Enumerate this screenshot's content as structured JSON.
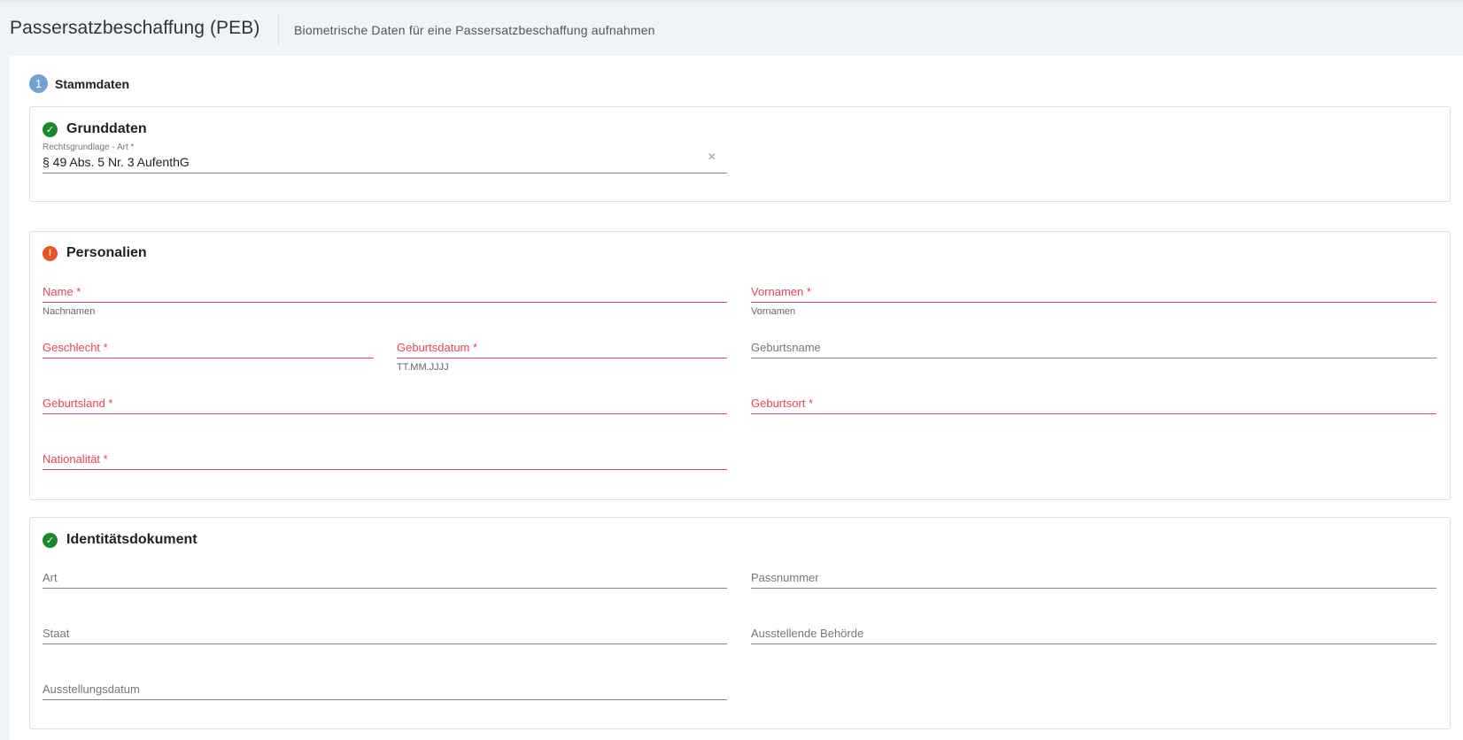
{
  "header": {
    "title": "Passersatzbeschaffung (PEB)",
    "subtitle": "Biometrische Daten für eine Passersatzbeschaffung aufnahmen"
  },
  "step": {
    "number": "1",
    "label": "Stammdaten"
  },
  "grunddaten": {
    "title": "Grunddaten",
    "status": "complete",
    "rechtsgrundlage_label": "Rechtsgrundlage - Art *",
    "rechtsgrundlage_value": "§ 49 Abs. 5 Nr. 3 AufenthG",
    "clear_glyph": "×"
  },
  "personalien": {
    "title": "Personalien",
    "status": "error",
    "fields": {
      "name": {
        "label": "Name *",
        "hint": "Nachnamen"
      },
      "vornamen": {
        "label": "Vornamen *",
        "hint": "Vornamen"
      },
      "geschlecht": {
        "label": "Geschlecht *"
      },
      "geburtsdatum": {
        "label": "Geburtsdatum *",
        "hint": "TT.MM.JJJJ"
      },
      "geburtsname": {
        "label": "Geburtsname"
      },
      "geburtsland": {
        "label": "Geburtsland *"
      },
      "geburtsort": {
        "label": "Geburtsort *"
      },
      "nationalitaet": {
        "label": "Nationalität *"
      }
    }
  },
  "identitaetsdokument": {
    "title": "Identitätsdokument",
    "status": "complete",
    "fields": {
      "art": {
        "label": "Art"
      },
      "passnummer": {
        "label": "Passnummer"
      },
      "staat": {
        "label": "Staat"
      },
      "behoerde": {
        "label": "Ausstellende Behörde"
      },
      "ausstellungsdatum": {
        "label": "Ausstellungsdatum"
      }
    }
  },
  "icons": {
    "ok": "✓",
    "err": "!"
  },
  "colors": {
    "error": "#e8435d",
    "ok_icon": "#198a2e",
    "err_icon": "#ee5124",
    "step_badge": "#6fa1d2"
  }
}
